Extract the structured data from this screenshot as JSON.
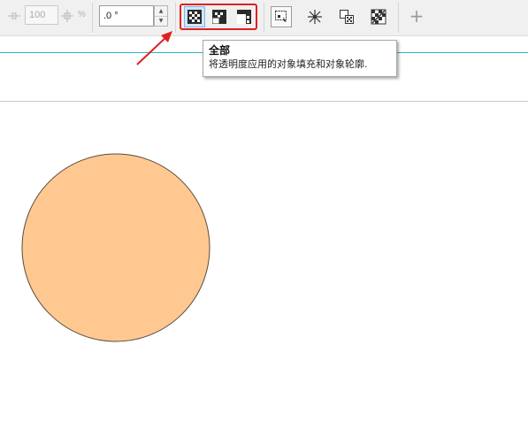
{
  "toolbar": {
    "size_value": "100",
    "percent_unit": "%",
    "angle_value": ".0 °",
    "transparency_target_buttons": [
      {
        "name": "all",
        "tooltip_title": "全部",
        "selected": true
      },
      {
        "name": "fill",
        "selected": false
      },
      {
        "name": "outline",
        "selected": false
      }
    ],
    "add_symbol": "+",
    "icons": {
      "size_icon": "node-minus-icon",
      "step_icon": "node-plus-icon",
      "spin_up": "▲",
      "spin_down": "▼"
    }
  },
  "tooltip": {
    "title": "全部",
    "description": "将透明度应用的对象填充和对象轮廓."
  },
  "canvas": {
    "shape": "circle",
    "fill_color": "#FFC891",
    "stroke_color": "#5b4b3e"
  },
  "annotation": {
    "highlight_color": "#E02020"
  }
}
